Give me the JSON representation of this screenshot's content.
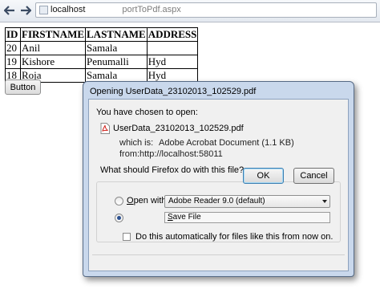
{
  "browser": {
    "url_host": "localhost",
    "url_path": "portToPdf.aspx"
  },
  "table": {
    "headers": [
      "ID",
      "FIRSTNAME",
      "LASTNAME",
      "ADDRESS"
    ],
    "rows": [
      [
        "20",
        "Anil",
        "Samala",
        ""
      ],
      [
        "19",
        "Kishore",
        "Penumalli",
        "Hyd"
      ],
      [
        "18",
        "Roja",
        "Samala",
        "Hyd"
      ]
    ]
  },
  "page_button_label": "Button",
  "dialog": {
    "title": "Opening UserData_23102013_102529.pdf",
    "intro": "You have chosen to open:",
    "file_name": "UserData_23102013_102529.pdf",
    "which_is_label": "which is:",
    "which_is_value": "Adobe Acrobat Document (1.1 KB)",
    "from_label": "from:",
    "from_value": "http://localhost:58011",
    "question": "What should Firefox do with this file?",
    "open_with_label": "Open with",
    "open_with_app": "Adobe Reader 9.0 (default)",
    "save_file_label": "Save File",
    "save_file_selected": true,
    "auto_label": "Do this automatically for files like this from now on.",
    "ok_label": "OK",
    "cancel_label": "Cancel"
  },
  "colors": {
    "dialog_frame": "#c9d8ec",
    "dialog_body": "#f0f0f0",
    "ok_border": "#3c7fb1"
  }
}
